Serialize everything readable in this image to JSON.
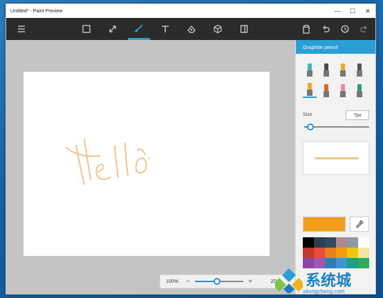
{
  "window": {
    "title": "Untitled* - Paint Preview"
  },
  "titlebar_buttons": {
    "minimize": "—",
    "maximize": "☐",
    "close": "✕"
  },
  "toolbar": {
    "tools": [
      {
        "name": "menu-icon"
      },
      {
        "name": "select-icon"
      },
      {
        "name": "crop-icon"
      },
      {
        "name": "brush-icon",
        "active": true
      },
      {
        "name": "text-icon"
      },
      {
        "name": "stickers-icon"
      },
      {
        "name": "3d-shapes-icon"
      },
      {
        "name": "canvas-icon"
      },
      {
        "name": "paste-icon"
      },
      {
        "name": "undo-icon"
      },
      {
        "name": "history-icon"
      },
      {
        "name": "redo-icon"
      }
    ]
  },
  "drawing": {
    "ink_color": "#f0c48a"
  },
  "zoom": {
    "level": "100%",
    "minus": "−",
    "plus": "+",
    "mode": "2D",
    "slider_fraction": 0.45
  },
  "panel": {
    "title": "Graphite pencil",
    "brushes": [
      {
        "name": "marker-icon",
        "color": "#3fb5c0"
      },
      {
        "name": "calligraphy-pen-icon",
        "color": "#4a4a4a"
      },
      {
        "name": "oil-brush-icon",
        "color": "#f5a623"
      },
      {
        "name": "fountain-pen-icon",
        "color": "#555"
      },
      {
        "name": "pencil-icon",
        "color": "#f5a623",
        "selected": true
      },
      {
        "name": "crayon-icon",
        "color": "#e95c2b"
      },
      {
        "name": "eraser-icon",
        "color": "#f08aa0"
      },
      {
        "name": "fill-bucket-icon",
        "color": "#2aa06a"
      }
    ],
    "size_label": "Size",
    "size_value": "7px",
    "size_fraction": 0.1,
    "current_color": "#f39c1e",
    "palette": [
      "#000000",
      "#2d3e50",
      "#34495e",
      "#b08b8b",
      "#8e9aa6",
      "#ffffff",
      "#c0392b",
      "#e74c3c",
      "#e67e22",
      "#f39c12",
      "#f1c40f",
      "#f5e6a0",
      "#8e44ad",
      "#9b59b6",
      "#2980b9",
      "#3498db",
      "#16a085",
      "#27ae60"
    ]
  },
  "watermark": {
    "text": "系统城",
    "url": "xitongcheng.com"
  }
}
